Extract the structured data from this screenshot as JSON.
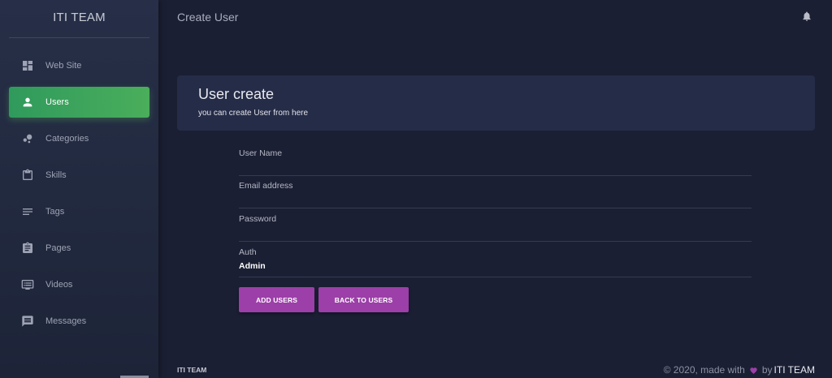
{
  "brand": "ITI TEAM",
  "page_title": "Create User",
  "sidebar": {
    "items": [
      {
        "label": "Web Site",
        "icon": "dashboard-icon"
      },
      {
        "label": "Users",
        "icon": "person-icon",
        "active": true
      },
      {
        "label": "Categories",
        "icon": "bubble-chart-icon"
      },
      {
        "label": "Skills",
        "icon": "clipboard-icon"
      },
      {
        "label": "Tags",
        "icon": "notes-icon"
      },
      {
        "label": "Pages",
        "icon": "assignment-icon"
      },
      {
        "label": "Videos",
        "icon": "video-list-icon"
      },
      {
        "label": "Messages",
        "icon": "message-icon"
      }
    ]
  },
  "card": {
    "title": "User create",
    "subtitle": "you can create User from here"
  },
  "form": {
    "user_name_label": "User Name",
    "email_label": "Email address",
    "password_label": "Password",
    "auth_label": "Auth",
    "auth_value": "Admin",
    "add_button": "ADD USERS",
    "back_button": "BACK TO USERS"
  },
  "footer": {
    "left": "ITI TEAM",
    "right_prefix": "© 2020, made with",
    "right_by": "by",
    "right_team": "ITI TEAM"
  },
  "colors": {
    "background": "#1b1f33",
    "active_nav": "#4aae5b",
    "button": "#9c3fa8"
  }
}
